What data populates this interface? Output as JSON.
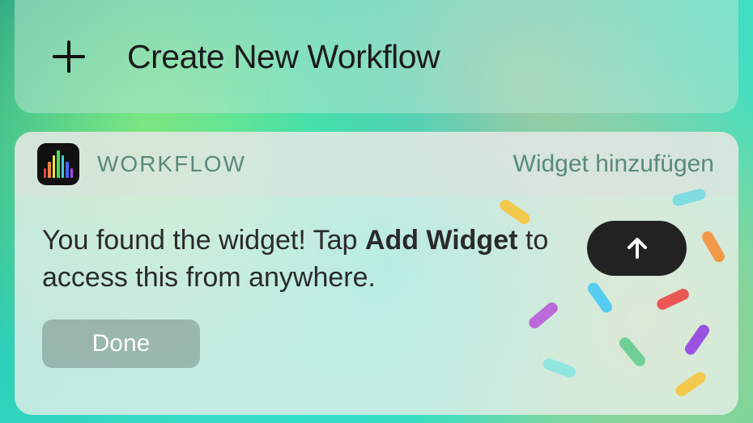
{
  "create": {
    "label": "Create New Workflow"
  },
  "widget": {
    "app_name": "WORKFLOW",
    "add_link": "Widget hinzufügen",
    "message_pre": "You found the widget! Tap ",
    "message_bold": "Add Widget",
    "message_post": " to access this from anywhere.",
    "done_label": "Done"
  }
}
